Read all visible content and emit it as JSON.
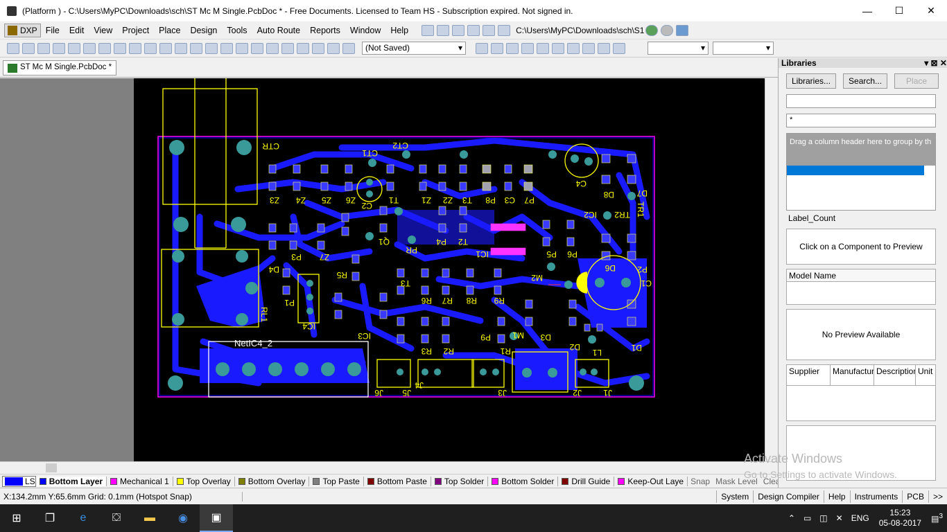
{
  "window": {
    "title": "(Platform ) - C:\\Users\\MyPC\\Downloads\\sch\\ST Mc M Single.PcbDoc * - Free Documents. Licensed to Team HS - Subscription expired. Not signed in.",
    "minimize": "—",
    "maximize": "☐",
    "close": "✕"
  },
  "menu": {
    "dxp": "DXP",
    "items": [
      "File",
      "Edit",
      "View",
      "Project",
      "Place",
      "Design",
      "Tools",
      "Auto Route",
      "Reports",
      "Window",
      "Help"
    ],
    "path": "C:\\Users\\MyPC\\Downloads\\sch\\S1"
  },
  "toolbar": {
    "saved_state": "(Not Saved)"
  },
  "doc_tab": {
    "label": "ST Mc M Single.PcbDoc *"
  },
  "pcb": {
    "labels": [
      "CTR",
      "CT1",
      "CT2",
      "C4",
      "C2",
      "Z3",
      "Z4",
      "Z5",
      "Z6",
      "T1",
      "Z1",
      "Z2",
      "T3",
      "P8",
      "C3",
      "P7",
      "D8",
      "IC2",
      "TR2",
      "TR1",
      "D7",
      "D4",
      "P3",
      "Z7",
      "Q1",
      "PR",
      "P4",
      "T2",
      "IC1",
      "P5",
      "P6",
      "D6",
      "C1",
      "P2",
      "RL1",
      "IC4",
      "R5",
      "T3",
      "R6",
      "R7",
      "R8",
      "R9",
      "M2",
      "P1",
      "IC3",
      "P9",
      "R3",
      "R2",
      "R1",
      "D3",
      "M1",
      "D2",
      "L1",
      "D1",
      "NetIC4_2",
      "J6",
      "J5",
      "J3",
      "J2",
      "J1",
      "J4"
    ]
  },
  "layers": {
    "ls": "LS",
    "tabs": [
      {
        "name": "Bottom Layer",
        "color": "#0000ff",
        "active": true
      },
      {
        "name": "Mechanical 1",
        "color": "#ff00ff"
      },
      {
        "name": "Top Overlay",
        "color": "#ffff00"
      },
      {
        "name": "Bottom Overlay",
        "color": "#808000"
      },
      {
        "name": "Top Paste",
        "color": "#808080"
      },
      {
        "name": "Bottom Paste",
        "color": "#800000"
      },
      {
        "name": "Top Solder",
        "color": "#800080"
      },
      {
        "name": "Bottom Solder",
        "color": "#ff00ff"
      },
      {
        "name": "Drill Guide",
        "color": "#800000"
      },
      {
        "name": "Keep-Out Laye",
        "color": "#ff00ff"
      }
    ],
    "tail": [
      "Snap",
      "Mask Level",
      "Clear"
    ]
  },
  "status": {
    "coord": "X:134.2mm Y:65.6mm   Grid: 0.1mm     (Hotspot Snap)",
    "buttons": [
      "System",
      "Design Compiler",
      "Help",
      "Instruments",
      "PCB",
      ">>"
    ]
  },
  "libraries": {
    "title": "Libraries",
    "btn_libraries": "Libraries...",
    "btn_search": "Search...",
    "btn_place": "Place",
    "filter": "*",
    "group_hint": "Drag a column header here to group by th",
    "label_count": "Label_Count",
    "preview": "Click on a Component to Preview",
    "model_name": "Model Name",
    "no_preview": "No Preview Available",
    "cols": [
      "Supplier",
      "Manufacture",
      "Description",
      "Unit"
    ]
  },
  "watermark": {
    "line1": "Activate Windows",
    "line2": "Go to Settings to activate Windows."
  },
  "taskbar": {
    "lang": "ENG",
    "time": "15:23",
    "date": "05-08-2017",
    "notif": "3"
  }
}
